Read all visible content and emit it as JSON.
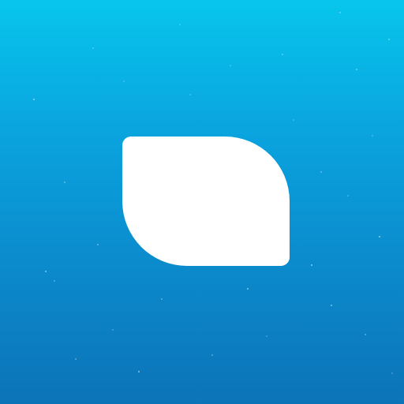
{
  "app_icon": {
    "background_gradient": [
      "#07c6ec",
      "#0aa6e0",
      "#0b8dce",
      "#0c73b8"
    ],
    "star_color": "#ffffff",
    "shape": {
      "icon": "leaf-shape-icon",
      "color": "#ffffff"
    }
  }
}
